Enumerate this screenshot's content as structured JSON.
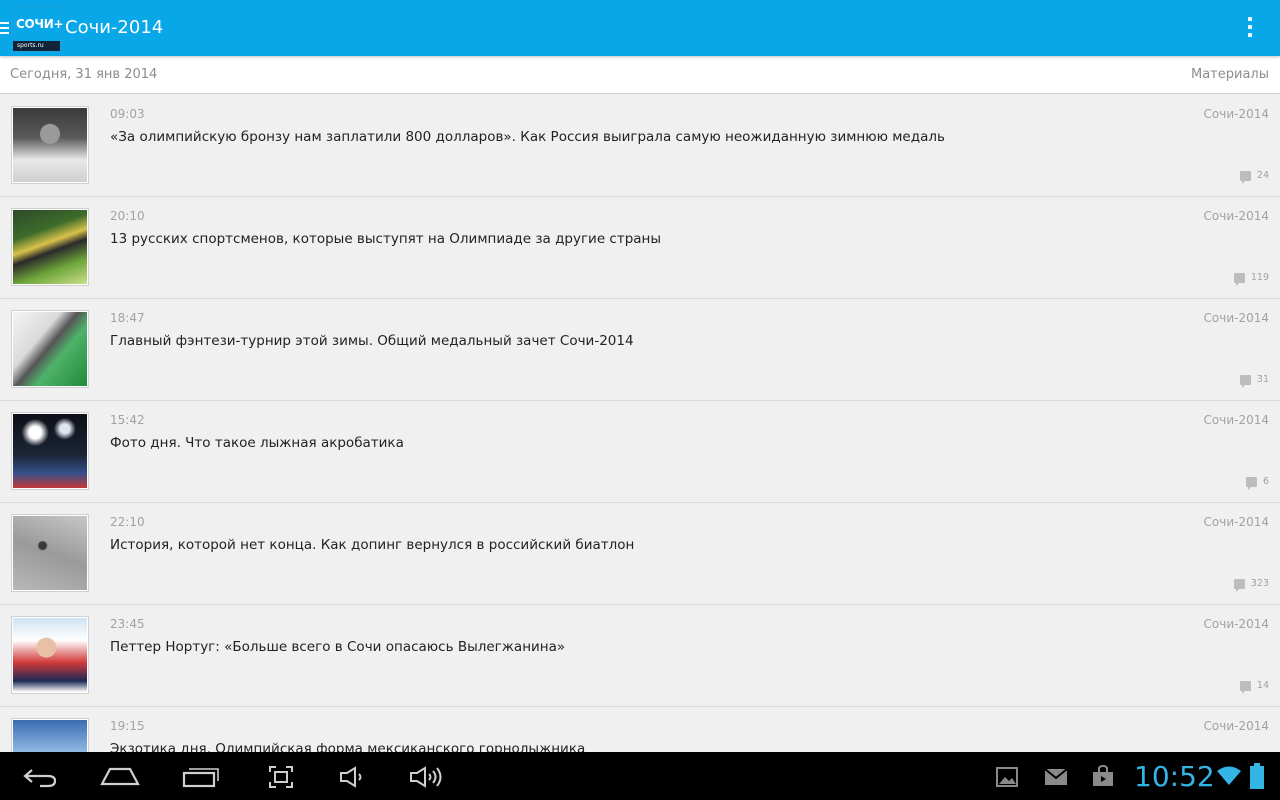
{
  "app": {
    "title": "Сочи-2014",
    "logo_top": "СОЧИ+",
    "logo_bottom": "sports.ru"
  },
  "datebar": {
    "date": "Сегодня, 31 янв 2014",
    "section": "Материалы"
  },
  "articles": [
    {
      "time": "09:03",
      "category": "Сочи-2014",
      "headline": "«За олимпийскую бронзу нам заплатили 800 долларов». Как Россия выиграла самую неожиданную зимнюю медаль",
      "comments": "24"
    },
    {
      "time": "20:10",
      "category": "Сочи-2014",
      "headline": "13 русских спортсменов, которые выступят на Олимпиаде за другие страны",
      "comments": "119"
    },
    {
      "time": "18:47",
      "category": "Сочи-2014",
      "headline": "Главный фэнтези-турнир этой зимы. Общий медальный зачет Сочи-2014",
      "comments": "31"
    },
    {
      "time": "15:42",
      "category": "Сочи-2014",
      "headline": "Фото дня. Что такое лыжная акробатика",
      "comments": "6"
    },
    {
      "time": "22:10",
      "category": "Сочи-2014",
      "headline": "История, которой нет конца. Как допинг вернулся в российский биатлон",
      "comments": "323"
    },
    {
      "time": "23:45",
      "category": "Сочи-2014",
      "headline": "Петтер Нортуг: «Больше всего в Сочи опасаюсь Вылегжанина»",
      "comments": "14"
    },
    {
      "time": "19:15",
      "category": "Сочи-2014",
      "headline": "Экзотика дня. Олимпийская форма мексиканского горнолыжника",
      "comments": ""
    }
  ],
  "statusbar": {
    "clock": "10:52",
    "accent": "#33b5e5"
  },
  "icons": {
    "back": "back-icon",
    "home": "home-icon",
    "recents": "recent-apps-icon",
    "screenshot": "screenshot-icon",
    "vol_down": "volume-down-icon",
    "vol_up": "volume-up-icon",
    "gallery": "gallery-notification-icon",
    "gmail": "gmail-notification-icon",
    "store": "store-notification-icon",
    "wifi": "wifi-icon",
    "battery": "battery-icon"
  },
  "colors": {
    "actionbar": "#08a7e8"
  }
}
